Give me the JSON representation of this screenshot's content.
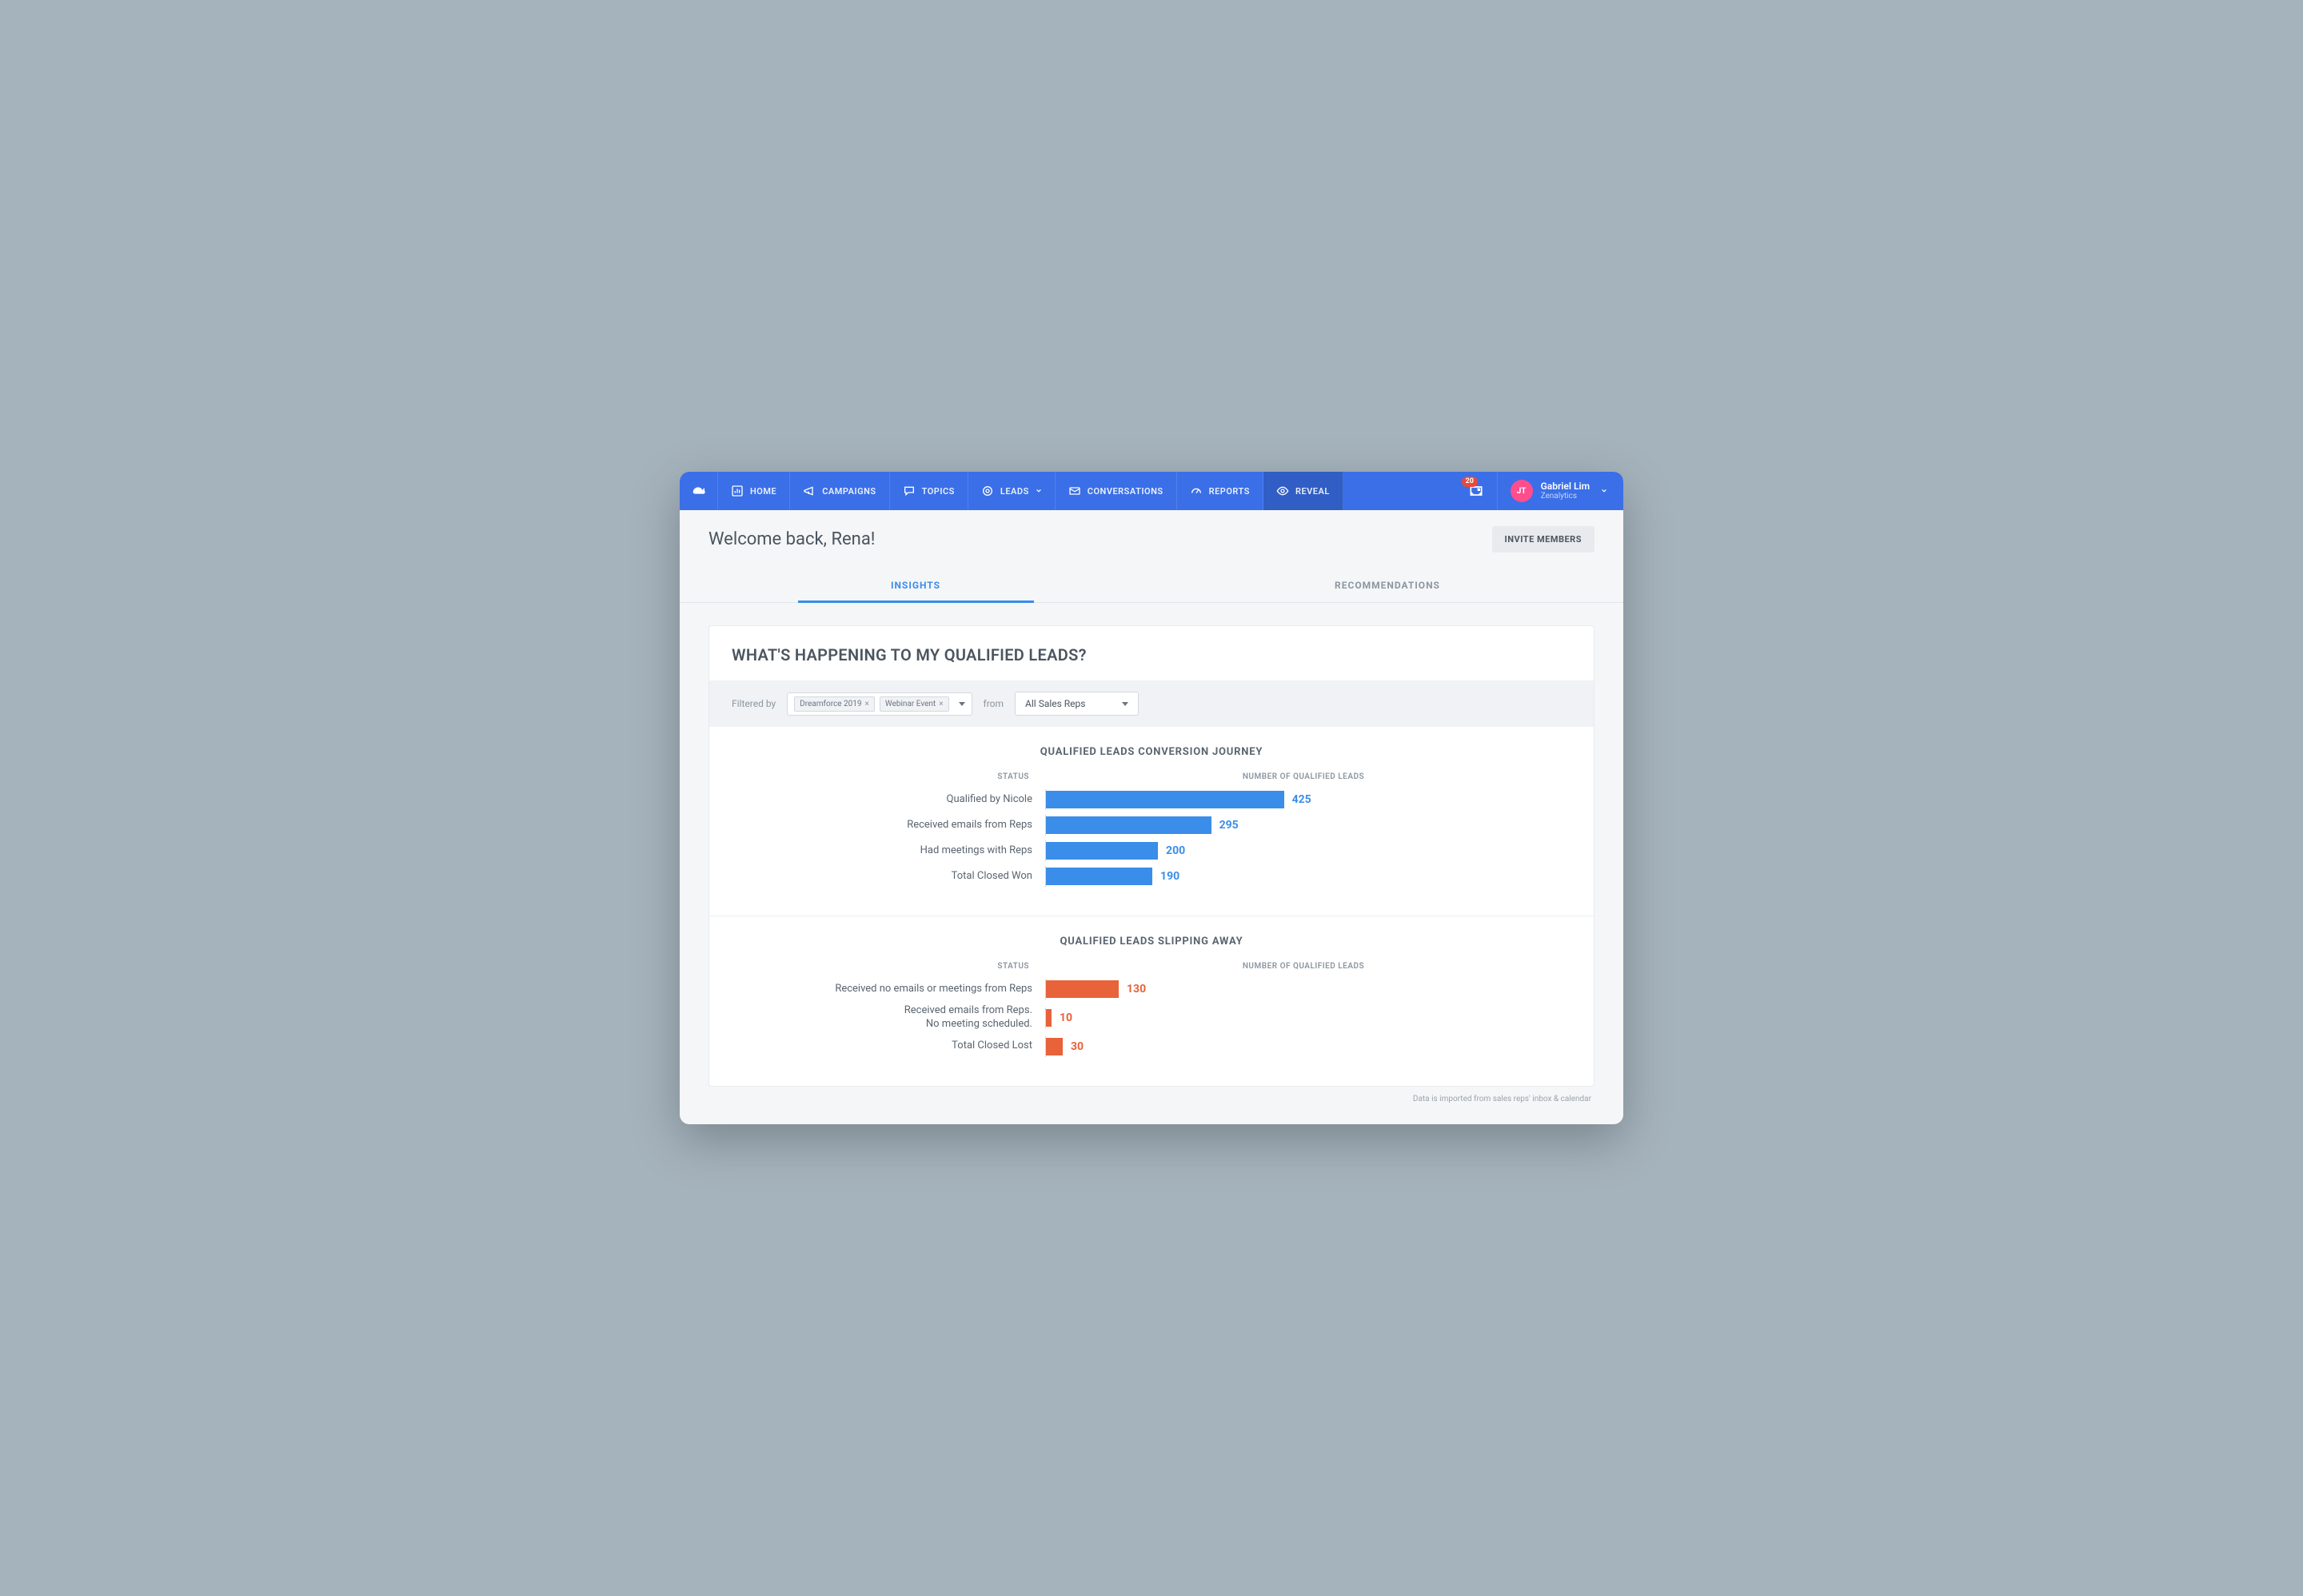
{
  "nav": {
    "home": "HOME",
    "campaigns": "CAMPAIGNS",
    "topics": "TOPICS",
    "leads": "LEADS",
    "conversations": "CONVERSATIONS",
    "reports": "REPORTS",
    "reveal": "REVEAL"
  },
  "notif_count": "20",
  "user": {
    "initials": "JT",
    "name": "Gabriel Lim",
    "org": "Zenalytics"
  },
  "welcome": "Welcome back, Rena!",
  "invite": "INVITE MEMBERS",
  "subtabs": {
    "insights": "INSIGHTS",
    "recommendations": "RECOMMENDATIONS"
  },
  "card_title": "WHAT'S HAPPENING TO MY QUALIFIED LEADS?",
  "filter": {
    "filtered_by": "Filtered by",
    "chip1": "Dreamforce 2019",
    "chip2": "Webinar Event",
    "from": "from",
    "select_value": "All Sales Reps"
  },
  "col_status": "STATUS",
  "col_count": "NUMBER OF QUALIFIED LEADS",
  "chart_data": [
    {
      "type": "bar",
      "title": "QUALIFIED LEADS CONVERSION JOURNEY",
      "color": "blue",
      "max": 425,
      "series": [
        {
          "label": "Qualified by Nicole",
          "value": 425
        },
        {
          "label": "Received emails from Reps",
          "value": 295
        },
        {
          "label": "Had meetings with Reps",
          "value": 200
        },
        {
          "label": "Total Closed Won",
          "value": 190
        }
      ]
    },
    {
      "type": "bar",
      "title": "QUALIFIED LEADS SLIPPING AWAY",
      "color": "red",
      "max": 425,
      "series": [
        {
          "label": "Received no emails or meetings from Reps",
          "value": 130
        },
        {
          "label": "Received emails from Reps.\nNo meeting scheduled.",
          "value": 10
        },
        {
          "label": "Total Closed Lost",
          "value": 30
        }
      ]
    }
  ],
  "footnote": "Data is imported from sales reps' inbox & calendar"
}
